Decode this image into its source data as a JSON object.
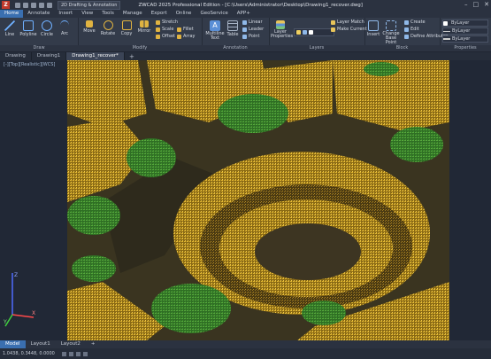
{
  "window": {
    "title": "ZWCAD 2025 Professional Edition - [C:\\Users\\Administrator\\Desktop\\Drawing1_recover.dwg]",
    "workspace": "2D Drafting & Annotation",
    "logo": "Z",
    "controls": [
      "–",
      "□",
      "✕"
    ]
  },
  "menu": {
    "tabs": [
      "Home",
      "Annotate",
      "Insert",
      "View",
      "Tools",
      "Manage",
      "Export",
      "Online",
      "GeoService",
      "APP+"
    ]
  },
  "ribbon": {
    "draw": {
      "title": "Draw",
      "tools": [
        "Line",
        "Polyline",
        "Circle",
        "Arc"
      ]
    },
    "modify": {
      "title": "Modify",
      "tools": [
        "Move",
        "Rotate",
        "Copy",
        "Mirror"
      ],
      "small": [
        "Stretch",
        "Scale",
        "Offset",
        "Fillet",
        "Array"
      ]
    },
    "annotation": {
      "title": "Annotation",
      "tools": [
        "Multiline Text",
        "Table"
      ],
      "small": [
        "Linear",
        "Leader",
        "Point"
      ]
    },
    "layers": {
      "title": "Layers",
      "tools": [
        "Layer Properties"
      ],
      "small": [
        "Layer Match",
        "Make Current"
      ]
    },
    "block": {
      "title": "Block",
      "tools": [
        "Insert",
        "Change Base Point"
      ],
      "small": [
        "Create",
        "Edit",
        "Define Attributes"
      ]
    },
    "properties": {
      "title": "Properties",
      "values": [
        "ByLayer",
        "ByLayer",
        "ByLayer"
      ]
    }
  },
  "doc_tabs": [
    "Drawing",
    "Drawing1",
    "Drawing1_recover*"
  ],
  "viewport": {
    "label": "[-][Top][Realistic][WCS]"
  },
  "layout_tabs": [
    "Model",
    "Layout1",
    "Layout2"
  ],
  "status": {
    "coords": "1.0438, 0.3448, 0.0000"
  },
  "ucs": {
    "x": "X",
    "y": "Y",
    "z": "Z"
  },
  "colors": {
    "point_cloud": "#d4a62a",
    "trees": "#3f8f2e",
    "accent": "#3a6fb0"
  }
}
